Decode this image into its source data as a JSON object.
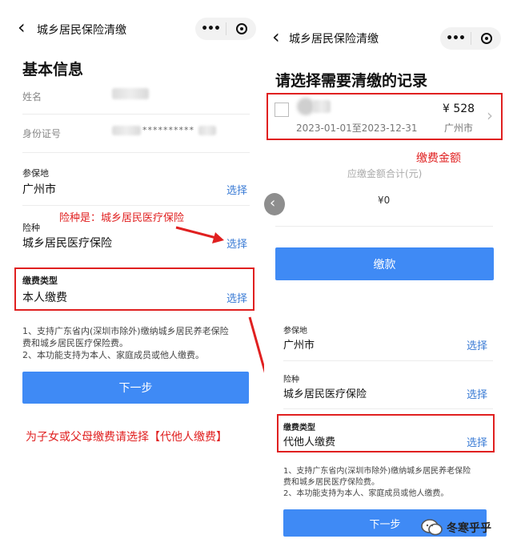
{
  "left": {
    "nav": {
      "back": "‹",
      "title": "城乡居民保险清缴",
      "more": "•••"
    },
    "heading": "基本信息",
    "name_label": "姓名",
    "id_label": "身份证号",
    "id_value": "**********",
    "region": {
      "label": "参保地",
      "value": "广州市",
      "action": "选择"
    },
    "insurance": {
      "label": "险种",
      "value": "城乡居民医疗保险",
      "action": "选择"
    },
    "payer": {
      "label": "缴费类型",
      "value": "本人缴费",
      "action": "选择"
    },
    "notes": [
      "1、支持广东省内(深圳市除外)缴纳城乡居民养老保险",
      "费和城乡居民医疗保险费。",
      "2、本功能支持为本人、家庭成员或他人缴费。"
    ],
    "next_button": "下一步",
    "annotation_insurance": "险种是：城乡居民医疗保险",
    "annotation_bottom": "为子女或父母缴费请选择【代他人缴费】"
  },
  "right": {
    "nav": {
      "back": "‹",
      "title": "城乡居民保险清缴",
      "more": "•••"
    },
    "heading": "请选择需要清缴的记录",
    "record": {
      "period": "2023-01-01至2023-12-31",
      "amount": "¥ 528",
      "city": "广州市",
      "chevron": "›"
    },
    "annotation_amount": "缴费金额",
    "total_label": "应缴金额合计(元)",
    "total_value": "¥0",
    "prev_arrow": "‹",
    "pay_button": "缴款",
    "region": {
      "label": "参保地",
      "value": "广州市",
      "action": "选择"
    },
    "insurance": {
      "label": "险种",
      "value": "城乡居民医疗保险",
      "action": "选择"
    },
    "payer": {
      "label": "缴费类型",
      "value": "代他人缴费",
      "action": "选择"
    },
    "notes": [
      "1、支持广东省内(深圳市除外)缴纳城乡居民养老保险",
      "费和城乡居民医疗保险费。",
      "2、本功能支持为本人、家庭成员或他人缴费。"
    ],
    "next_button": "下一步",
    "watermark": "冬寒乎乎"
  },
  "colors": {
    "accent": "#3f8af5",
    "link": "#3a7bd5",
    "annotation": "#e02020"
  }
}
